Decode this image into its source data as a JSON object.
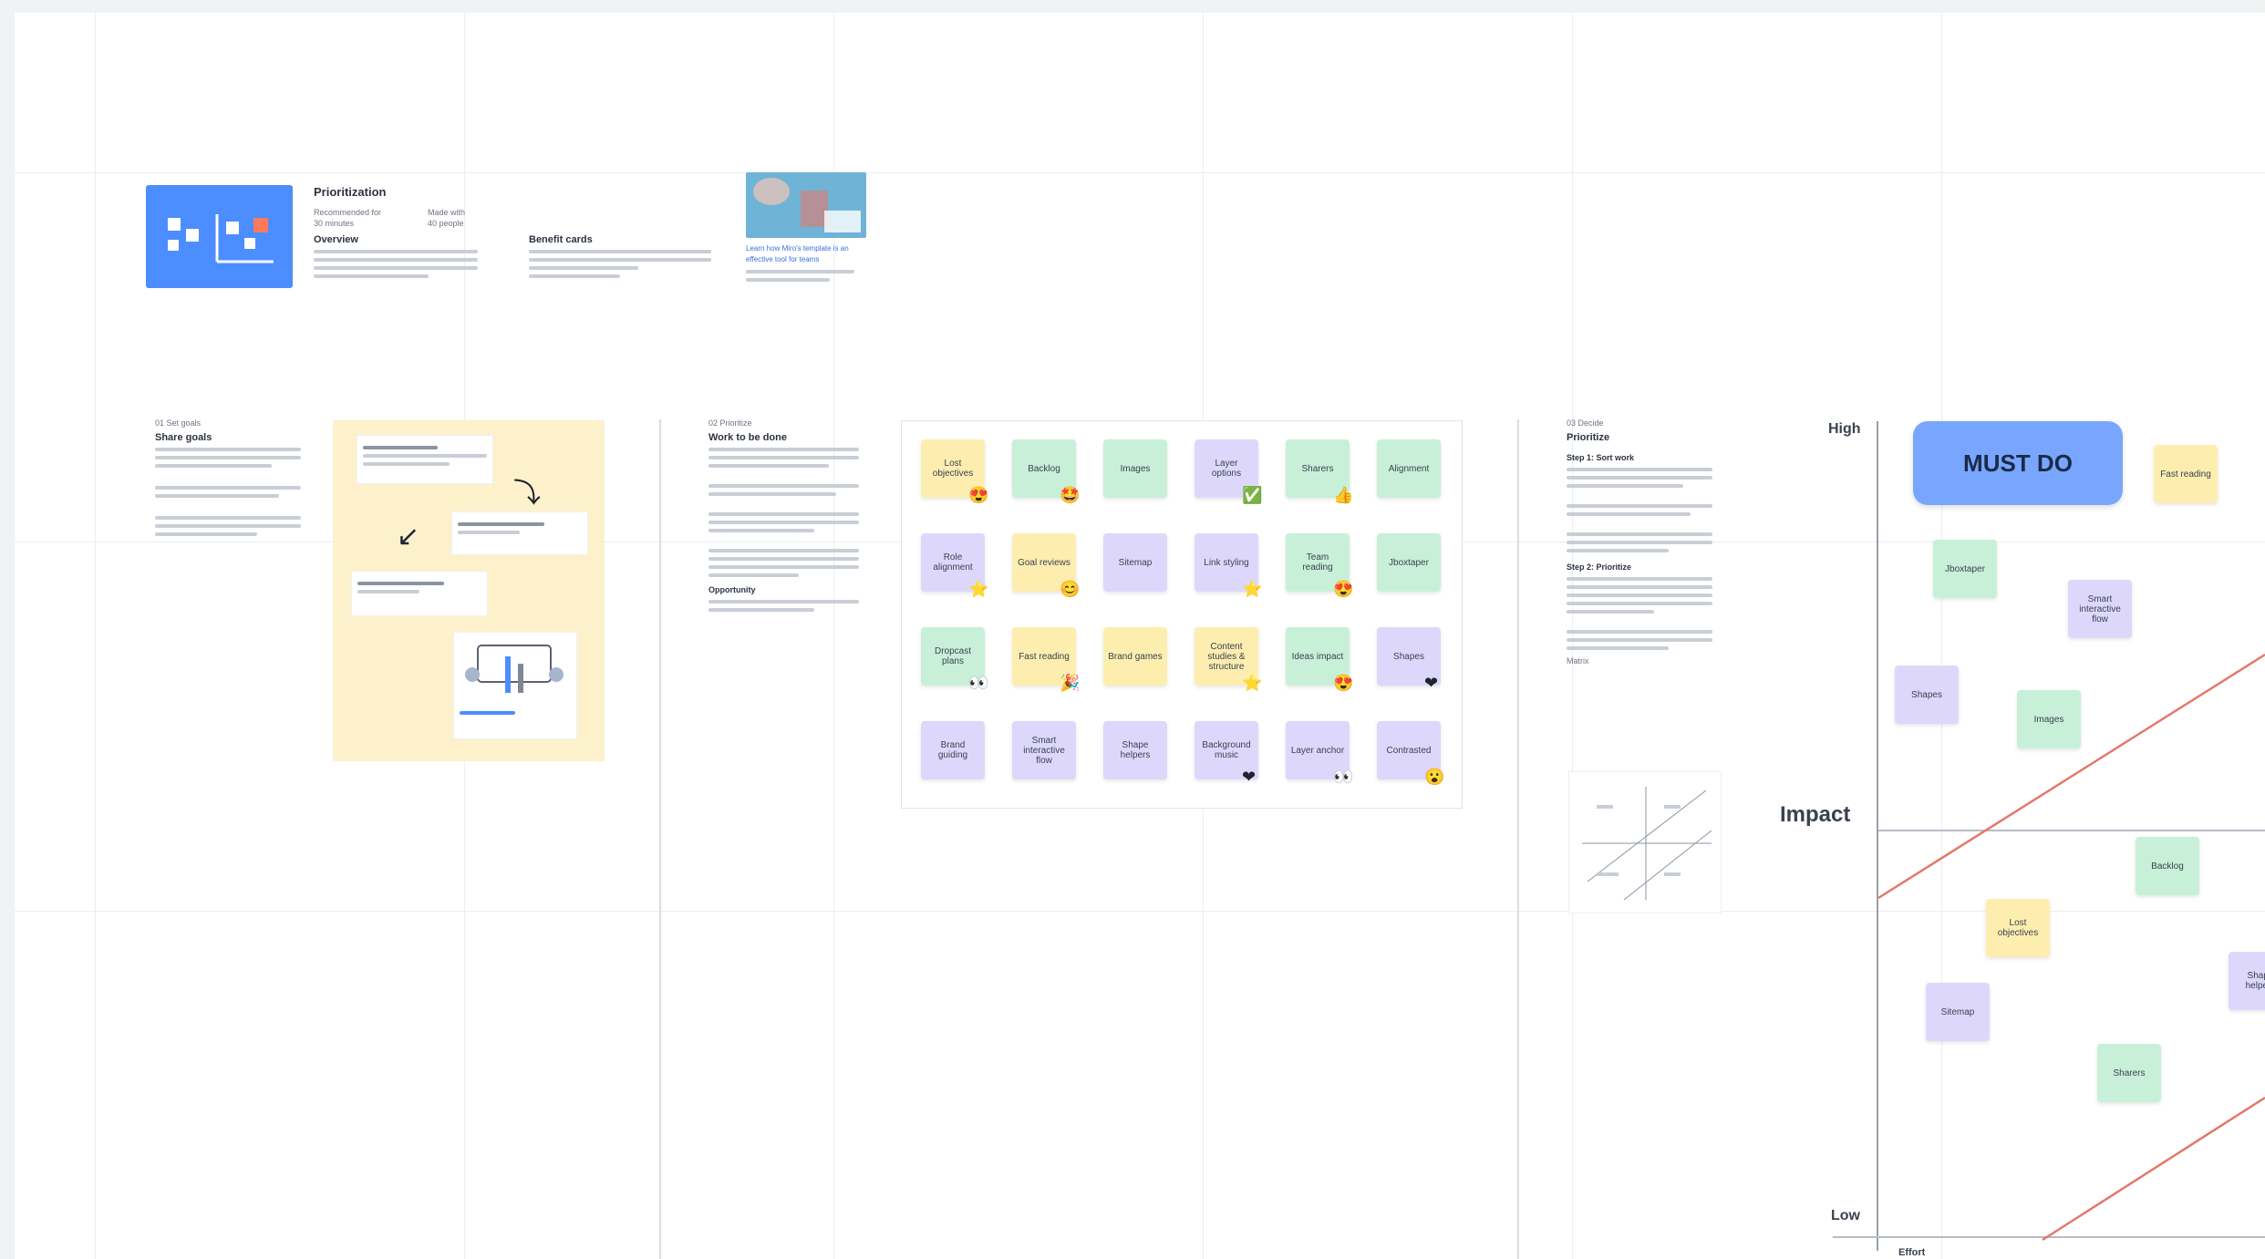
{
  "intro": {
    "title": "Prioritization",
    "meta_a": "Recommended for",
    "meta_a_sub": "30 minutes",
    "meta_b": "Made with",
    "meta_b_sub": "40 people",
    "overview_head": "Overview",
    "benefits_head": "Benefit cards",
    "video_link": "Learn how Miro's template is an effective tool for teams"
  },
  "sections": {
    "goals": {
      "tag": "01 Set goals",
      "title": "Share goals"
    },
    "work": {
      "tag": "02 Prioritize",
      "title": "Work to be done",
      "subhead": "Opportunity"
    },
    "prioritize": {
      "tag": "03 Decide",
      "title": "Prioritize",
      "step1": "Step 1: Sort work",
      "step2": "Step 2: Prioritize",
      "matrix_label": "Matrix"
    }
  },
  "stickies": [
    {
      "text": "Lost objectives",
      "color": "y"
    },
    {
      "text": "Backlog",
      "color": "g"
    },
    {
      "text": "Images",
      "color": "g"
    },
    {
      "text": "Layer options",
      "color": "p"
    },
    {
      "text": "Sharers",
      "color": "g"
    },
    {
      "text": "Alignment",
      "color": "g"
    },
    {
      "text": "Role alignment",
      "color": "p"
    },
    {
      "text": "Goal reviews",
      "color": "y"
    },
    {
      "text": "Sitemap",
      "color": "p"
    },
    {
      "text": "Link styling",
      "color": "p"
    },
    {
      "text": "Team reading",
      "color": "g"
    },
    {
      "text": "Jboxtaper",
      "color": "g"
    },
    {
      "text": "Dropcast plans",
      "color": "g"
    },
    {
      "text": "Fast reading",
      "color": "y"
    },
    {
      "text": "Brand games",
      "color": "y"
    },
    {
      "text": "Content studies & structure",
      "color": "y"
    },
    {
      "text": "Ideas impact",
      "color": "g"
    },
    {
      "text": "Shapes",
      "color": "p"
    },
    {
      "text": "Brand guiding",
      "color": "p"
    },
    {
      "text": "Smart interactive flow",
      "color": "p"
    },
    {
      "text": "Shape helpers",
      "color": "p"
    },
    {
      "text": "Background music",
      "color": "p"
    },
    {
      "text": "Layer anchor",
      "color": "p"
    },
    {
      "text": "Contrasted",
      "color": "p"
    }
  ],
  "matrix": {
    "must_do": "MUST DO",
    "high": "High",
    "low": "Low",
    "impact": "Impact",
    "x_axis": "Effort",
    "notes": [
      {
        "text": "Fast reading",
        "color": "y"
      },
      {
        "text": "Jboxtaper",
        "color": "g"
      },
      {
        "text": "Smart interactive flow",
        "color": "p"
      },
      {
        "text": "Shapes",
        "color": "p"
      },
      {
        "text": "Images",
        "color": "g"
      },
      {
        "text": "Backlog",
        "color": "g"
      },
      {
        "text": "Lost objectives",
        "color": "y"
      },
      {
        "text": "Sitemap",
        "color": "p"
      },
      {
        "text": "Sharers",
        "color": "g"
      },
      {
        "text": "Shape helpers",
        "color": "p"
      }
    ]
  },
  "colors": {
    "yellow": "#fdeeb0",
    "green": "#c8f0d8",
    "purple": "#ddd8fb",
    "blue": "#78a6ff",
    "red_line": "#e4786b"
  }
}
